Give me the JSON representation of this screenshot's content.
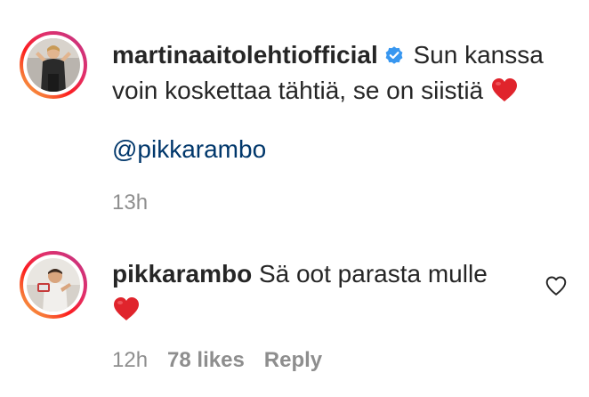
{
  "comments": [
    {
      "username": "martinaaitolehtiofficial",
      "verified": true,
      "text_line1": "Sun kanssa",
      "text_line2": "voin koskettaa tähtiä, se on siistiä",
      "mention": "@pikkarambo",
      "time": "13h"
    },
    {
      "username": "pikkarambo",
      "verified": false,
      "text": "Sä oot parasta mulle",
      "time": "12h",
      "likes": "78 likes",
      "reply_label": "Reply"
    }
  ],
  "icons": {
    "verified": "verified-badge-icon",
    "heart_emoji": "red-heart-emoji",
    "like": "heart-outline-icon"
  },
  "colors": {
    "verified_blue": "#3897f0",
    "mention": "#00376b",
    "meta_gray": "#8e8e8e",
    "heart_red": "#e0242c"
  }
}
